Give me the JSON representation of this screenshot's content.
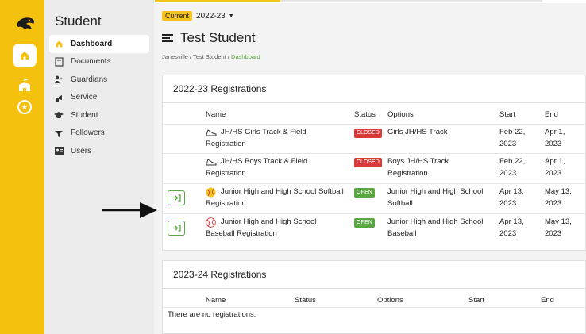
{
  "rail": {
    "logo_icon": "panther-logo-icon",
    "home_icon": "home-icon",
    "school_icon": "school-icon",
    "star_icon": "star-icon"
  },
  "sidebar": {
    "title": "Student",
    "items": [
      {
        "label": "Dashboard",
        "icon": "home-icon",
        "active": true
      },
      {
        "label": "Documents",
        "icon": "document-icon"
      },
      {
        "label": "Guardians",
        "icon": "guardians-icon"
      },
      {
        "label": "Service",
        "icon": "service-icon"
      },
      {
        "label": "Student",
        "icon": "graduation-cap-icon"
      },
      {
        "label": "Followers",
        "icon": "followers-icon"
      },
      {
        "label": "Users",
        "icon": "users-icon"
      }
    ]
  },
  "header": {
    "current_badge": "Current",
    "term": "2022-23",
    "title": "Test Student"
  },
  "breadcrumb": {
    "part1": "Janesville",
    "sep": " / ",
    "part2": "Test Student",
    "part3": "Dashboard"
  },
  "registrations_2022": {
    "title": "2022-23 Registrations",
    "columns": [
      "Name",
      "Status",
      "Options",
      "Start",
      "End"
    ],
    "rows": [
      {
        "name1": "JH/HS Girls Track & Field",
        "name2": "Registration",
        "status": "CLOSED",
        "options1": "Girls JH/HS Track",
        "options2": "",
        "start1": "Feb 22,",
        "start2": "2023",
        "end1": "Apr 1,",
        "end2": "2023",
        "icon": "running-shoe-icon"
      },
      {
        "name1": "JH/HS Boys Track & Field",
        "name2": "Registration",
        "status": "CLOSED",
        "options1": "Boys JH/HS Track",
        "options2": "Registration",
        "start1": "Feb 22,",
        "start2": "2023",
        "end1": "Apr 1,",
        "end2": "2023",
        "icon": "running-shoe-icon"
      },
      {
        "name1": "Junior High and High School Softball",
        "name2": "Registration",
        "status": "OPEN",
        "options1": "Junior High and High School",
        "options2": "Softball",
        "start1": "Apr 13,",
        "start2": "2023",
        "end1": "May 13,",
        "end2": "2023",
        "icon": "softball-icon"
      },
      {
        "name1": "Junior High and High School",
        "name2": "Baseball Registration",
        "status": "OPEN",
        "options1": "Junior High and High School",
        "options2": "Baseball",
        "start1": "Apr 13,",
        "start2": "2023",
        "end1": "May 13,",
        "end2": "2023",
        "icon": "baseball-icon"
      }
    ]
  },
  "registrations_2023": {
    "title": "2023-24 Registrations",
    "columns": [
      "Name",
      "Status",
      "Options",
      "Start",
      "End"
    ],
    "empty_text": "There are no registrations."
  },
  "colors": {
    "accent_yellow": "#f4c10f",
    "open_green": "#5aa643",
    "closed_red": "#d83a3a"
  }
}
